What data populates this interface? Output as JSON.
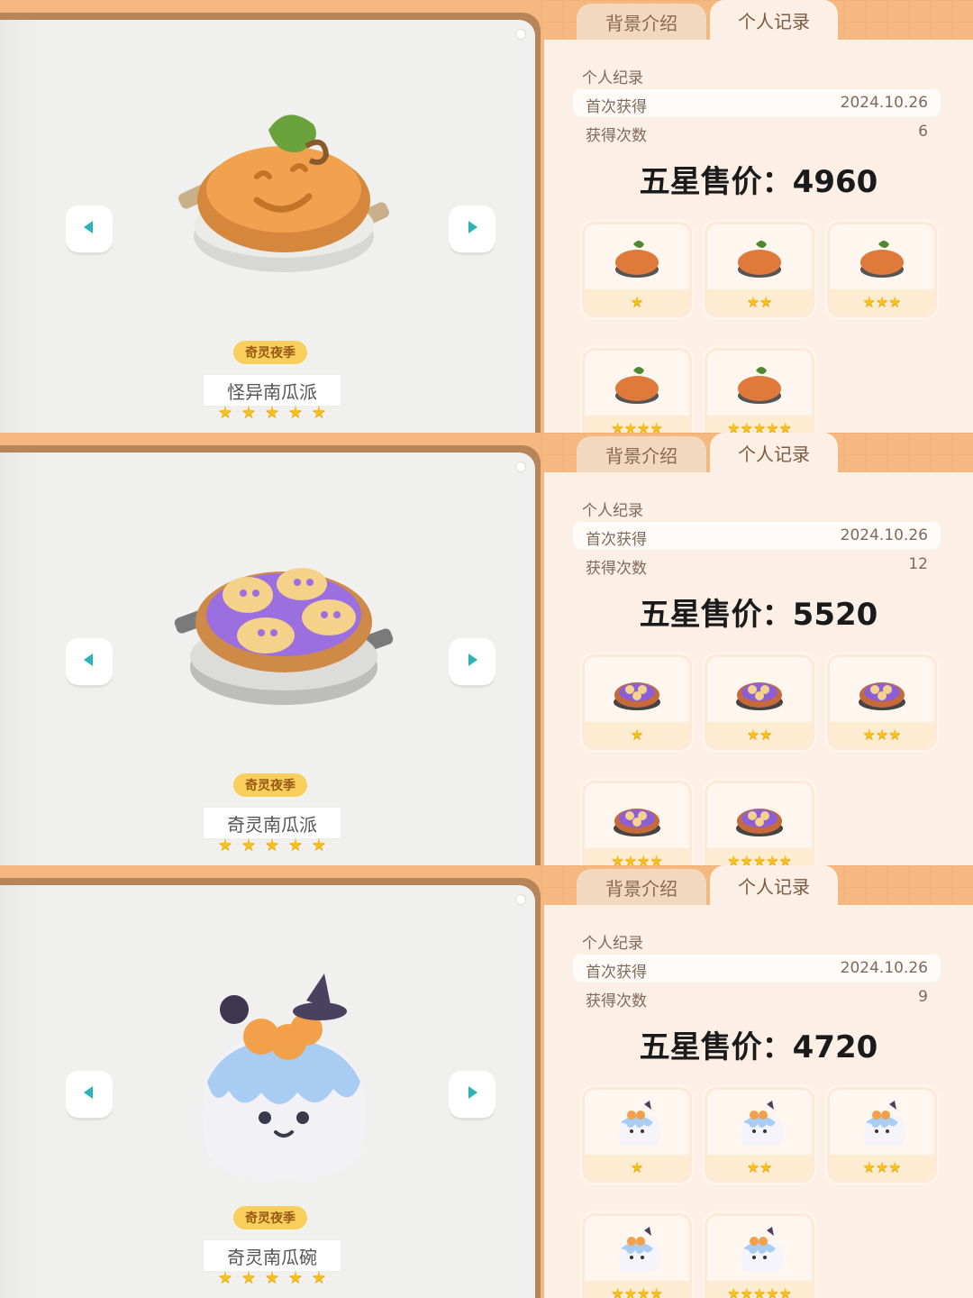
{
  "tabs": {
    "background": "背景介绍",
    "record": "个人记录"
  },
  "record_labels": {
    "title": "个人纪录",
    "first_obtained": "首次获得",
    "times_obtained": "获得次数"
  },
  "season_badge": "奇灵夜季",
  "colors": {
    "accent": "#f4b880",
    "star": "#f5c11f",
    "arrow": "#2bb3b6"
  },
  "panels": [
    {
      "dish_name": "怪异南瓜派",
      "name_stars": 5,
      "first_obtained": "2024.10.26",
      "times_obtained": "6",
      "price_label": "五星售价：4960",
      "variants": [
        1,
        2,
        3,
        4,
        5
      ],
      "dish_icon": "pumpkin-pie-icon"
    },
    {
      "dish_name": "奇灵南瓜派",
      "name_stars": 5,
      "first_obtained": "2024.10.26",
      "times_obtained": "12",
      "price_label": "五星售价：5520",
      "variants": [
        1,
        2,
        3,
        4,
        5
      ],
      "dish_icon": "ghost-pie-icon"
    },
    {
      "dish_name": "奇灵南瓜碗",
      "name_stars": 5,
      "first_obtained": "2024.10.26",
      "times_obtained": "9",
      "price_label": "五星售价：4720",
      "variants": [
        1,
        2,
        3,
        4,
        5
      ],
      "dish_icon": "ghost-cake-icon"
    }
  ]
}
